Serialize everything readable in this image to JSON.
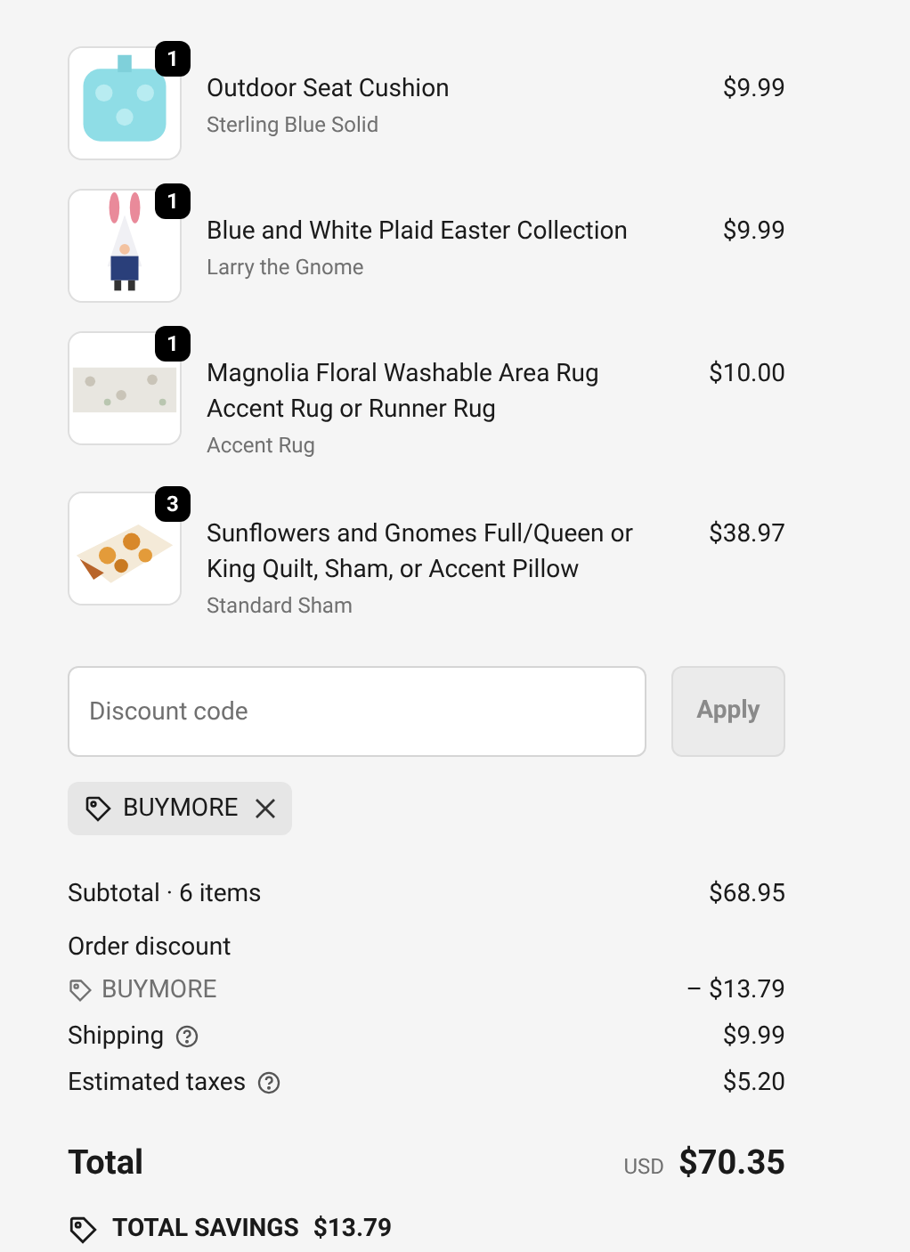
{
  "items": [
    {
      "name": "Outdoor Seat Cushion",
      "variant": "Sterling Blue Solid",
      "price": "$9.99",
      "quantity": "1"
    },
    {
      "name": "Blue and White Plaid Easter Collection",
      "variant": "Larry the Gnome",
      "price": "$9.99",
      "quantity": "1"
    },
    {
      "name": "Magnolia Floral Washable Area Rug Accent Rug or Runner Rug",
      "variant": "Accent Rug",
      "price": "$10.00",
      "quantity": "1"
    },
    {
      "name": "Sunflowers and Gnomes Full/Queen or King Quilt, Sham, or Accent Pillow",
      "variant": "Standard Sham",
      "price": "$38.97",
      "quantity": "3"
    }
  ],
  "discount": {
    "placeholder": "Discount code",
    "apply": {
      "label": "Apply",
      "disabled": true
    },
    "applied_codes": [
      "BUYMORE"
    ]
  },
  "summary": [
    {
      "kind": "line",
      "label": "Subtotal · 6 items",
      "value": "$68.95",
      "help": false
    },
    {
      "kind": "heading",
      "label": "Order discount"
    },
    {
      "kind": "code",
      "label": "BUYMORE",
      "value": "– $13.79"
    },
    {
      "kind": "line",
      "label": "Shipping",
      "value": "$9.99",
      "help": true
    },
    {
      "kind": "line",
      "label": "Estimated taxes",
      "value": "$5.20",
      "help": true
    }
  ],
  "total": {
    "label": "Total",
    "currency": "USD",
    "value": "$70.35"
  },
  "savings": {
    "label": "TOTAL SAVINGS",
    "value": "$13.79"
  }
}
